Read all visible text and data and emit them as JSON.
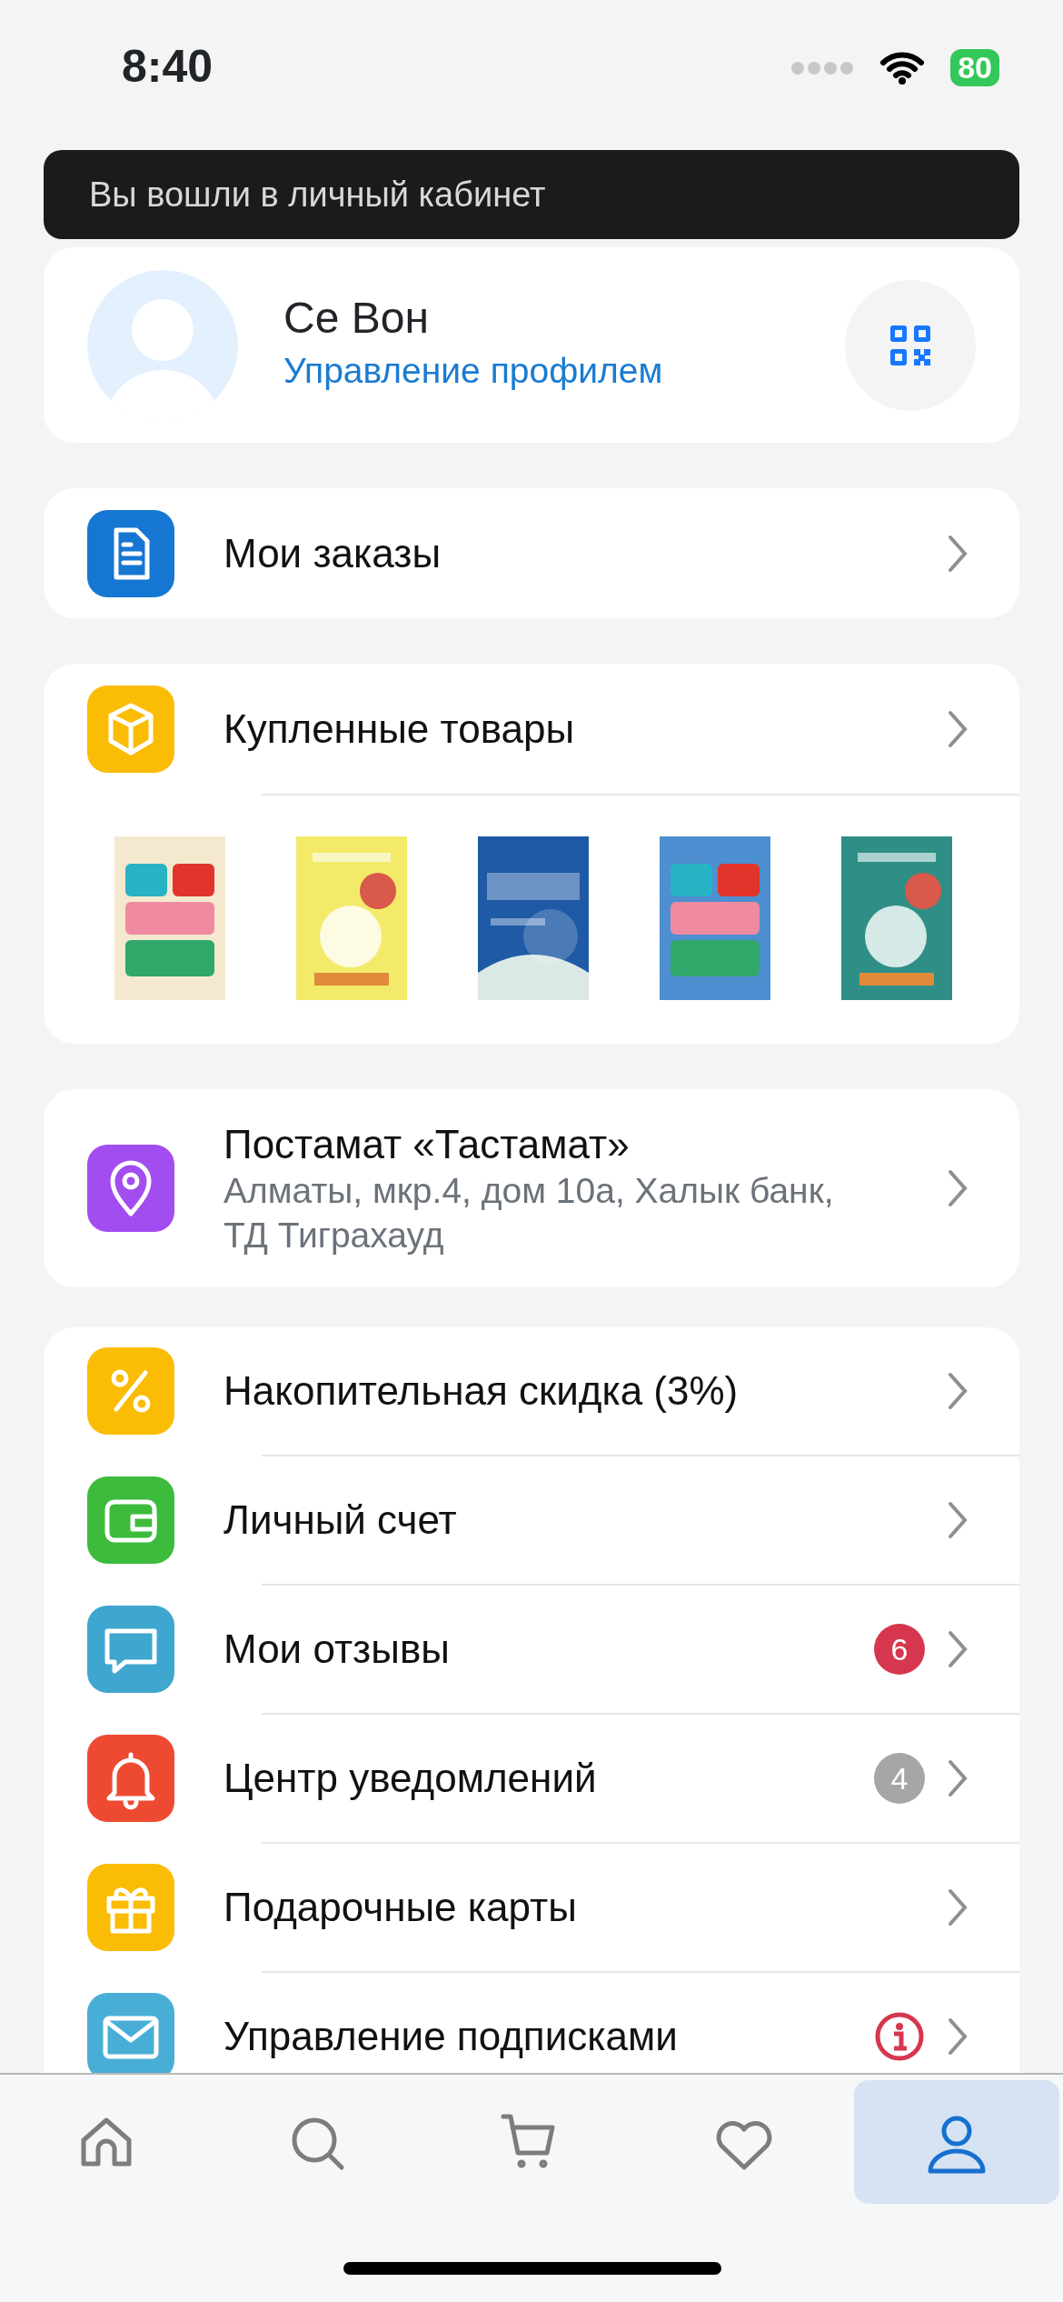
{
  "status_bar": {
    "time": "8:40",
    "battery": "80"
  },
  "toast": {
    "text": "Вы вошли в личный кабинет"
  },
  "profile": {
    "name": "Се Вон",
    "link": "Управление профилем"
  },
  "orders": {
    "label": "Мои заказы",
    "kind": "doc",
    "color": "#1677d2"
  },
  "purchased": {
    "label": "Купленные товары",
    "kind": "box",
    "color": "#fbbc05"
  },
  "pickup": {
    "title": "Постамат «Тастамат»",
    "address": "Алматы, мкр.4, дом 10а, Халык банк, ТД Тиграхауд",
    "kind": "pin",
    "color": "#a24df0"
  },
  "menu": [
    {
      "label": "Накопительная скидка (3%)",
      "kind": "percent",
      "color": "#fbbc05"
    },
    {
      "label": "Личный счет",
      "kind": "wallet",
      "color": "#3cbb3c"
    },
    {
      "label": "Мои отзывы",
      "kind": "chat",
      "color": "#3ea6cf",
      "badge": {
        "kind": "count",
        "text": "6",
        "color": "#d6374f"
      }
    },
    {
      "label": "Центр уведомлений",
      "kind": "bell",
      "color": "#ee4a32",
      "badge": {
        "kind": "count",
        "text": "4",
        "color": "#a6a6a6"
      }
    },
    {
      "label": "Подарочные карты",
      "kind": "gift",
      "color": "#fbbc05"
    },
    {
      "label": "Управление подписками",
      "kind": "mail",
      "color": "#49aed6",
      "badge": {
        "kind": "info",
        "color": "#d6374f"
      }
    }
  ],
  "tabs": [
    {
      "kind": "home",
      "selected": false
    },
    {
      "kind": "search",
      "selected": false
    },
    {
      "kind": "cart",
      "selected": false
    },
    {
      "kind": "heart",
      "selected": false
    },
    {
      "kind": "user",
      "selected": true
    }
  ]
}
